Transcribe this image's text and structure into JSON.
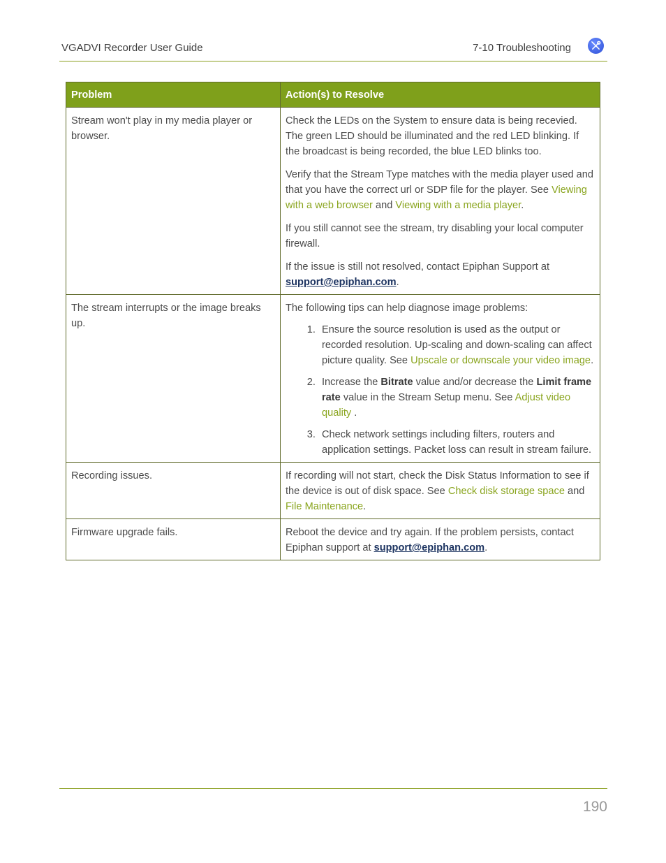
{
  "header": {
    "title": "VGADVI Recorder User Guide",
    "section": "7-10 Troubleshooting",
    "icon": "tools-icon",
    "icon_color": "#3d5ee8"
  },
  "table": {
    "columns": [
      "Problem",
      "Action(s) to Resolve"
    ],
    "header_color": "#7fa01b",
    "link_color": "#8aa51f",
    "rows": [
      {
        "problem": "Stream won't play in my media player or browser.",
        "actions": {
          "p1": "Check the LEDs on the System to ensure data is being recevied. The green LED should be illuminated and the red LED blinking. If the broadcast is being recorded, the blue LED blinks too.",
          "p2_pre": "Verify that the Stream Type matches with the media player used and that you have the correct url or SDP file for the player. See ",
          "p2_link1": "Viewing with a web browser",
          "p2_mid": " and ",
          "p2_link2": "Viewing with a media player",
          "p2_post": ".",
          "p3": "If you still cannot see the stream, try disabling your local computer firewall.",
          "p4_pre": "If the issue is still not resolved, contact Epiphan Support at ",
          "p4_email": "support@epiphan.com",
          "p4_post": "."
        }
      },
      {
        "problem": "The stream interrupts or the image breaks up.",
        "actions": {
          "intro": "The following tips can help diagnose image problems:",
          "tip1_pre": "Ensure the source resolution is used as the output or recorded resolution. Up-scaling and down-scaling can affect picture quality. See ",
          "tip1_link": "Upscale or downscale your video image",
          "tip1_post": ".",
          "tip2_a": "Increase the ",
          "tip2_b1": "Bitrate",
          "tip2_c": " value and/or decrease the ",
          "tip2_b2": "Limit frame rate",
          "tip2_d": " value in the Stream Setup menu. See ",
          "tip2_link": "Adjust video quality",
          "tip2_post": " .",
          "tip3": "Check network settings including filters, routers and application settings. Packet loss can result in stream failure."
        }
      },
      {
        "problem": "Recording issues.",
        "actions": {
          "pre": "If recording will not start, check the Disk Status Information to see if the device is out of disk space. See ",
          "link1": "Check disk storage space",
          "mid": " and ",
          "link2": "File Maintenance",
          "post": "."
        }
      },
      {
        "problem": "Firmware upgrade fails.",
        "actions": {
          "pre": "Reboot the device and try again. If the problem persists, contact Epiphan support at ",
          "email": "support@epiphan.com",
          "post": "."
        }
      }
    ]
  },
  "footer": {
    "page_number": "190"
  }
}
